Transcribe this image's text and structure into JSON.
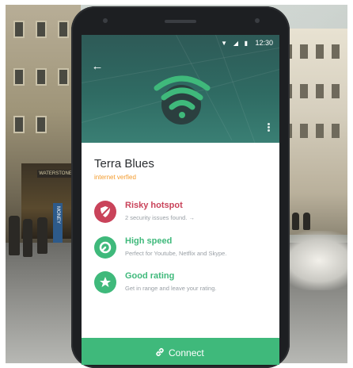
{
  "status_bar": {
    "time": "12:30"
  },
  "network": {
    "name": "Terra Blues",
    "status": "internet verfied"
  },
  "details": [
    {
      "title": "Risky hotspot",
      "description": "2 security issues found. →",
      "icon": "shield-slash-icon",
      "color": "#c9435a"
    },
    {
      "title": "High speed",
      "description": "Perfect for Youtube, Netflix and Skype.",
      "icon": "speed-gauge-icon",
      "color": "#3fb97b"
    },
    {
      "title": "Good rating",
      "description": "Get in range and leave your rating.",
      "icon": "star-icon",
      "color": "#3fb97b"
    }
  ],
  "connect": {
    "label": "Connect",
    "icon": "link-icon"
  },
  "background": {
    "shop_sign": "WATERSTONES",
    "blue_sign": "MONEY"
  },
  "colors": {
    "header": "#2f6b63",
    "accent": "#3fb97b",
    "warning": "#c9435a",
    "status_orange": "#f39b2c"
  }
}
